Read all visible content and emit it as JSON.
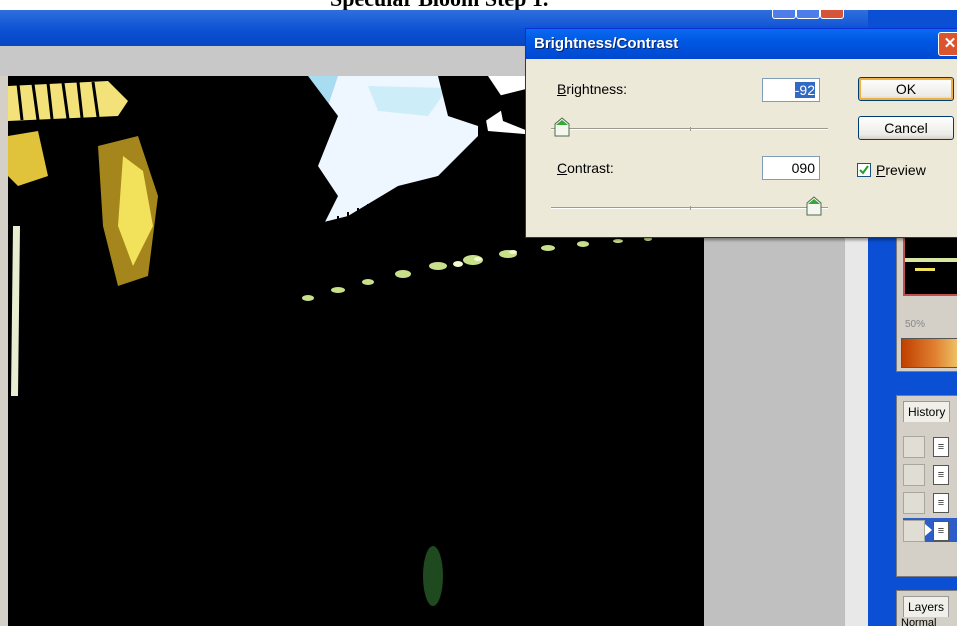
{
  "caption": {
    "title": "Specular Bloom Step 1."
  },
  "dialog": {
    "title": "Brightness/Contrast",
    "brightness": {
      "label_key": "B",
      "label_rest": "rightness:",
      "value": "-92",
      "slider_level": 0.04
    },
    "contrast": {
      "label_key": "C",
      "label_rest": "ontrast:",
      "value": "090",
      "slider_level": 0.95
    },
    "ok_label": "OK",
    "cancel_label": "Cancel",
    "preview": {
      "label_key": "P",
      "label_rest": "review",
      "checked": true
    }
  },
  "palettes": {
    "navigator": {
      "zoom": "50%"
    },
    "history": {
      "tab_label": "History",
      "rows": 4,
      "active_row": 3
    },
    "layers": {
      "tab_label": "Layers",
      "blend_mode": "Normal"
    }
  },
  "colors": {
    "titlebar": "#0a4fd4",
    "dialog_bg": "#ece9d8",
    "selection": "#316ac5",
    "close_red": "#d9542f"
  }
}
